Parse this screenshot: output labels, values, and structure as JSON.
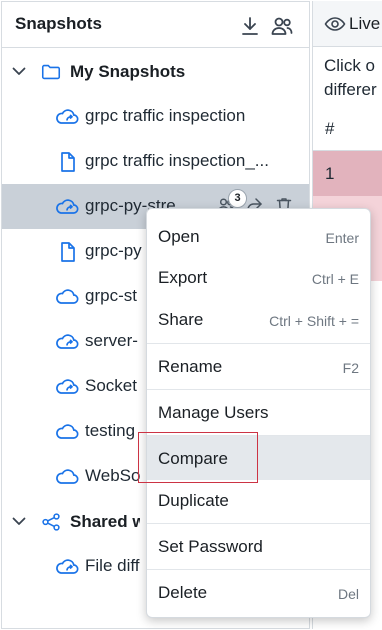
{
  "sidebar": {
    "title": "Snapshots",
    "download_icon": "download-icon",
    "users_icon": "manage-users-icon",
    "groups": [
      {
        "label": "My Snapshots",
        "icon": "folder-icon",
        "expanded": true
      },
      {
        "label": "Shared w",
        "icon": "share-nodes-icon",
        "expanded": true
      }
    ],
    "items": [
      {
        "label": "grpc traffic inspection",
        "icon": "cloud-share-icon"
      },
      {
        "label": "grpc traffic inspection_...",
        "icon": "file-icon"
      },
      {
        "label": "grpc-py-stre",
        "icon": "cloud-share-icon",
        "selected": true
      },
      {
        "label": "grpc-py",
        "icon": "file-icon"
      },
      {
        "label": "grpc-st",
        "icon": "cloud-icon"
      },
      {
        "label": "server-",
        "icon": "cloud-share-icon"
      },
      {
        "label": "Socket",
        "icon": "cloud-share-icon"
      },
      {
        "label": "testing",
        "icon": "cloud-icon"
      },
      {
        "label": "WebSo",
        "icon": "cloud-icon"
      }
    ],
    "shared_items": [
      {
        "label": "File diff",
        "icon": "cloud-share-icon"
      }
    ],
    "selected_actions": {
      "user_count": "3"
    }
  },
  "right_pane": {
    "tab_label": "Live",
    "hint_line1": "Click o",
    "hint_line2": "differer",
    "column_header": "#",
    "first_row": "1"
  },
  "context_menu": {
    "items": [
      {
        "label": "Open",
        "shortcut": "Enter"
      },
      {
        "label": "Export",
        "shortcut": "Ctrl + E"
      },
      {
        "label": "Share",
        "shortcut": "Ctrl + Shift + ="
      },
      {
        "label": "Rename",
        "shortcut": "F2"
      },
      {
        "label": "Manage Users",
        "shortcut": ""
      },
      {
        "label": "Compare",
        "shortcut": "",
        "hovered": true
      },
      {
        "label": "Duplicate",
        "shortcut": ""
      },
      {
        "label": "Set Password",
        "shortcut": ""
      },
      {
        "label": "Delete",
        "shortcut": "Del"
      }
    ]
  },
  "colors": {
    "selected_row": "#c9d0d8",
    "icon_blue": "#1a73e8",
    "diff_removed_strong": "#e2b3bd",
    "diff_removed_light": "#f4d3d9",
    "menu_hover": "#e4e8ec",
    "highlight_border": "#cc3344"
  }
}
